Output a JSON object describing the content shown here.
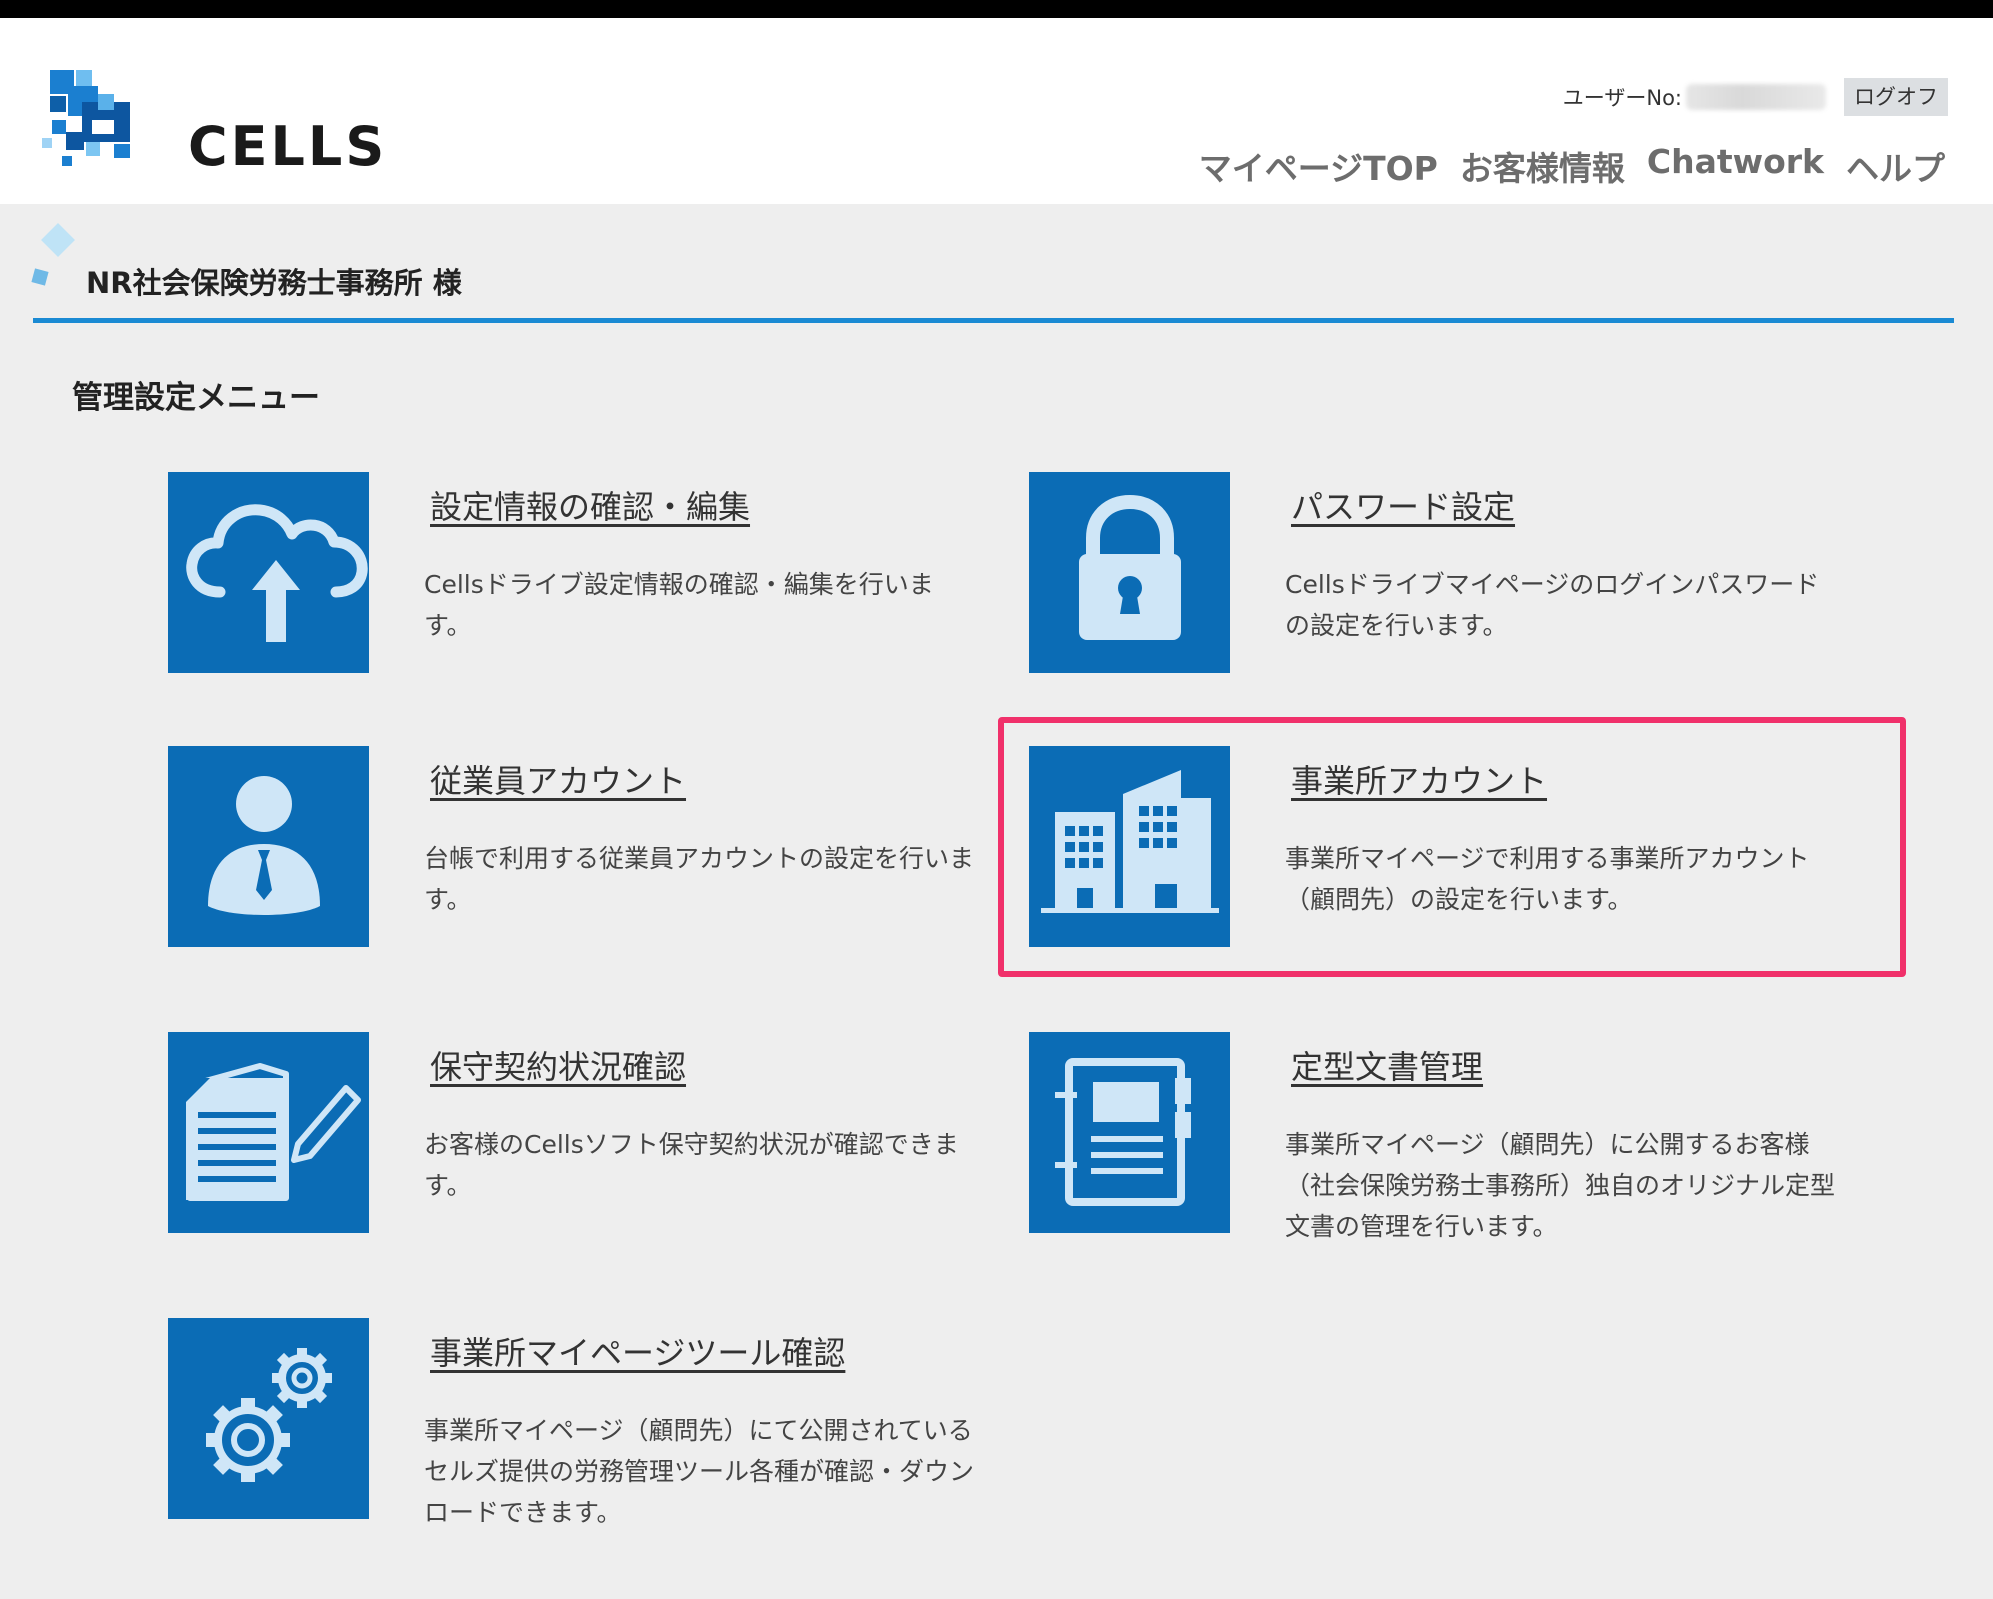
{
  "header": {
    "logo_text": "CELLS",
    "user_label": "ユーザーNo:",
    "logoff_label": "ログオフ",
    "nav": [
      {
        "label": "マイページTOP"
      },
      {
        "label": "お客様情報"
      },
      {
        "label": "Chatwork"
      },
      {
        "label": "ヘルプ"
      }
    ]
  },
  "welcome": {
    "text": "NR社会保険労務士事務所 様"
  },
  "menu": {
    "title": "管理設定メニュー",
    "items": [
      {
        "title": "設定情報の確認・編集",
        "desc": "Cellsドライブ設定情報の確認・編集を行います。",
        "icon": "cloud-upload-icon"
      },
      {
        "title": "パスワード設定",
        "desc": "Cellsドライブマイページのログインパスワードの設定を行います。",
        "icon": "lock-icon"
      },
      {
        "title": "従業員アカウント",
        "desc": "台帳で利用する従業員アカウントの設定を行います。",
        "icon": "employee-icon"
      },
      {
        "title": "事業所アカウント",
        "desc": "事業所マイページで利用する事業所アカウント（顧問先）の設定を行います。",
        "icon": "building-icon"
      },
      {
        "title": "保守契約状況確認",
        "desc": "お客様のCellsソフト保守契約状況が確認できます。",
        "icon": "document-pen-icon"
      },
      {
        "title": "定型文書管理",
        "desc": "事業所マイページ（顧問先）に公開するお客様（社会保険労務士事務所）独自のオリジナル定型文書の管理を行います。",
        "icon": "notebook-icon"
      },
      {
        "title": "事業所マイページツール確認",
        "desc": "事業所マイページ（顧問先）にて公開されているセルズ提供の労務管理ツール各種が確認・ダウンロードできます。",
        "icon": "gears-icon"
      }
    ]
  },
  "colors": {
    "tile_blue": "#0b6cb5",
    "accent_line": "#1a8ad3",
    "highlight": "#f0306a"
  }
}
